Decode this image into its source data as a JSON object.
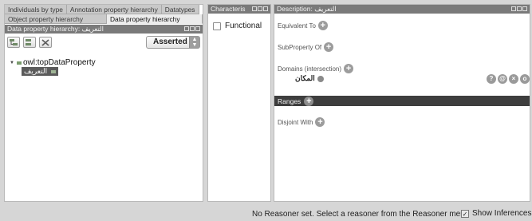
{
  "tabs_row1": [
    "Individuals by type",
    "Annotation property hierarchy",
    "Datatypes"
  ],
  "tabs_row2": [
    "Object property hierarchy",
    "Data property hierarchy"
  ],
  "data_property_view": {
    "title": "Data property hierarchy: التعريف",
    "asserted_label": "Asserted",
    "tree": {
      "root": "owl:topDataProperty",
      "child": "التعريف"
    }
  },
  "characteristics_view": {
    "title": "Characteris",
    "functional_label": "Functional",
    "functional_checked": false
  },
  "description_view": {
    "title": "Description: التعريف",
    "equivalent_to": "Equivalent To",
    "subproperty_of": "SubProperty Of",
    "domains": "Domains (intersection)",
    "domain_value": "المكان",
    "ranges": "Ranges",
    "disjoint_with": "Disjoint With"
  },
  "status_bar": {
    "message": "No Reasoner set. Select a reasoner from the Reasoner menu",
    "show_inferences": "Show Inferences",
    "show_inferences_checked": true
  },
  "icons": {
    "add": "+",
    "domain_buttons": [
      "?",
      "@",
      "×",
      "o"
    ]
  }
}
